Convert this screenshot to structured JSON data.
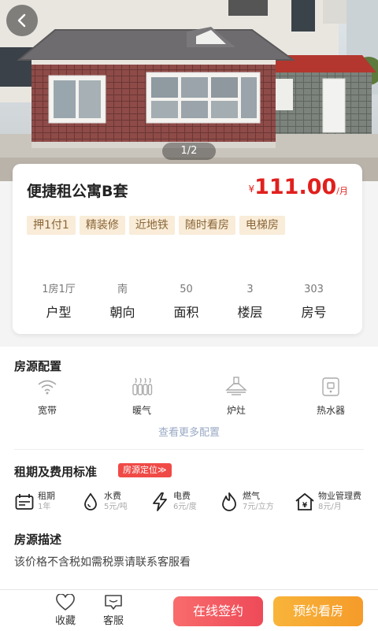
{
  "hero": {
    "counter": "1/2",
    "back_icon": "chevron-left-icon"
  },
  "listing": {
    "title": "便捷租公寓B套",
    "price_currency": "¥",
    "price": "111.00",
    "price_unit": "/月",
    "tags": [
      "押1付1",
      "精装修",
      "近地铁",
      "随时看房",
      "电梯房"
    ],
    "specs": [
      {
        "value": "1房1厅",
        "label": "户型"
      },
      {
        "value": "南",
        "label": "朝向"
      },
      {
        "value": "50",
        "label": "面积"
      },
      {
        "value": "3",
        "label": "楼层"
      },
      {
        "value": "303",
        "label": "房号"
      }
    ]
  },
  "amenities_section": {
    "title": "房源配置",
    "items": [
      {
        "label": "宽带",
        "icon": "wifi-icon"
      },
      {
        "label": "暖气",
        "icon": "heater-icon"
      },
      {
        "label": "炉灶",
        "icon": "range-hood-icon"
      },
      {
        "label": "热水器",
        "icon": "water-heater-icon"
      }
    ],
    "more_link": "查看更多配置"
  },
  "fees_section": {
    "title": "租期及费用标准",
    "badge": "房源定位≫",
    "items": [
      {
        "title": "租期",
        "sub": "1年",
        "icon": "calendar-icon"
      },
      {
        "title": "水费",
        "sub": "5元/吨",
        "icon": "water-drop-icon"
      },
      {
        "title": "电费",
        "sub": "6元/度",
        "icon": "lightning-icon"
      },
      {
        "title": "燃气",
        "sub": "7元/立方",
        "icon": "flame-icon"
      },
      {
        "title": "物业管理费",
        "sub": "8元/月",
        "icon": "house-yuan-icon"
      }
    ]
  },
  "description_section": {
    "title": "房源描述",
    "text": "该价格不含税如需税票请联系客服看"
  },
  "bottom_bar": {
    "favorite": "收藏",
    "service": "客服",
    "sign_online": "在线签约",
    "book_viewing": "预约看房"
  },
  "colors": {
    "price": "#e0201e",
    "tag_bg": "#f9ecd8",
    "badge": "#f04a46",
    "sign_btn": "#ef5a5f",
    "book_btn": "#f6a630"
  }
}
